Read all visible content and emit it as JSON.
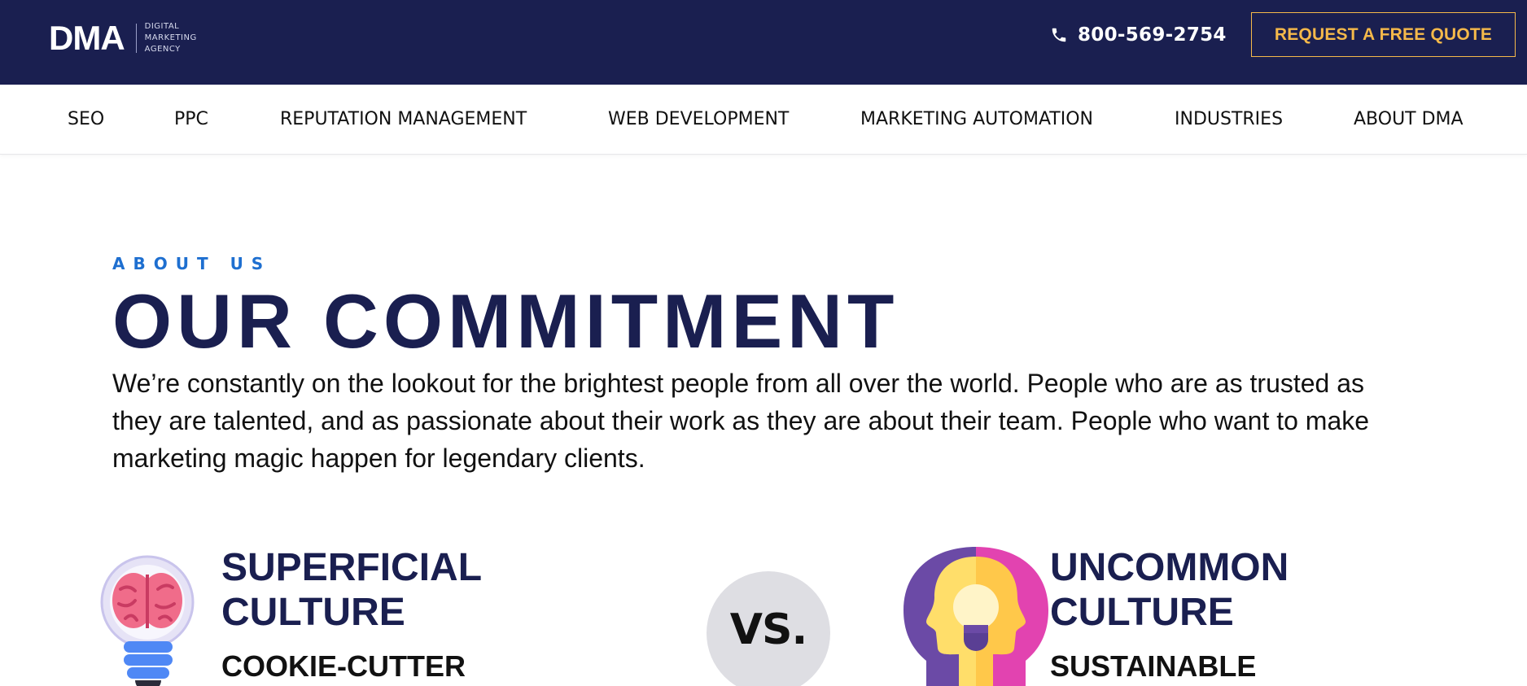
{
  "header": {
    "logo": {
      "mark": "DMA",
      "sub_lines": [
        "DIGITAL",
        "MARKETING",
        "AGENCY"
      ]
    },
    "phone": "800-569-2754",
    "cta": "REQUEST A FREE QUOTE",
    "colors": {
      "bar": "#1a1f50",
      "cta": "#f5b94a"
    }
  },
  "nav": {
    "items": [
      {
        "label": "SEO"
      },
      {
        "label": "PPC"
      },
      {
        "label": "REPUTATION MANAGEMENT"
      },
      {
        "label": "WEB DEVELOPMENT"
      },
      {
        "label": "MARKETING AUTOMATION"
      },
      {
        "label": "INDUSTRIES"
      },
      {
        "label": "ABOUT DMA"
      }
    ]
  },
  "hero": {
    "eyebrow": "ABOUT US",
    "title": "OUR COMMITMENT",
    "intro": "We’re constantly on the lookout for the brightest people from all over the world. People who are as trusted as they are talented, and as passionate about their work as they are about their team. People who want to make marketing magic happen for legendary clients."
  },
  "comparison": {
    "left": {
      "title_line1": "SUPERFICIAL",
      "title_line2": "CULTURE",
      "subtitle": "COOKIE-CUTTER",
      "icon": "brain-lightbulb-icon"
    },
    "vs": "VS.",
    "right": {
      "title_line1": "UNCOMMON",
      "title_line2": "CULTURE",
      "subtitle": "SUSTAINABLE",
      "icon": "head-lightbulb-icon"
    }
  }
}
